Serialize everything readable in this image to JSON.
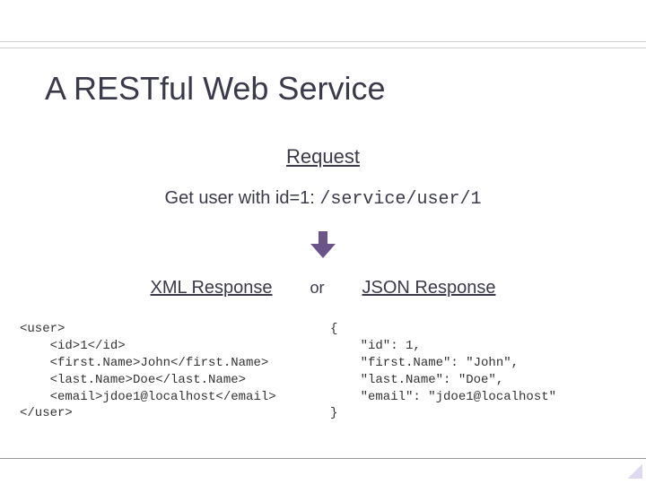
{
  "title": "A RESTful Web Service",
  "section": "Request",
  "request": {
    "prefix": "Get user with id=1: ",
    "path": "/service/user/1"
  },
  "responses": {
    "xml_label": "XML Response",
    "or": "or",
    "json_label": "JSON Response"
  },
  "xml_code": "<user>\n    <id>1</id>\n    <first.Name>John</first.Name>\n    <last.Name>Doe</last.Name>\n    <email>jdoe1@localhost</email>\n</user>",
  "json_code": "{\n    \"id\": 1,\n    \"first.Name\": \"John\",\n    \"last.Name\": \"Doe\",\n    \"email\": \"jdoe1@localhost\"\n}",
  "arrow": {
    "color": "#6a548a",
    "width": 28,
    "height": 30
  }
}
